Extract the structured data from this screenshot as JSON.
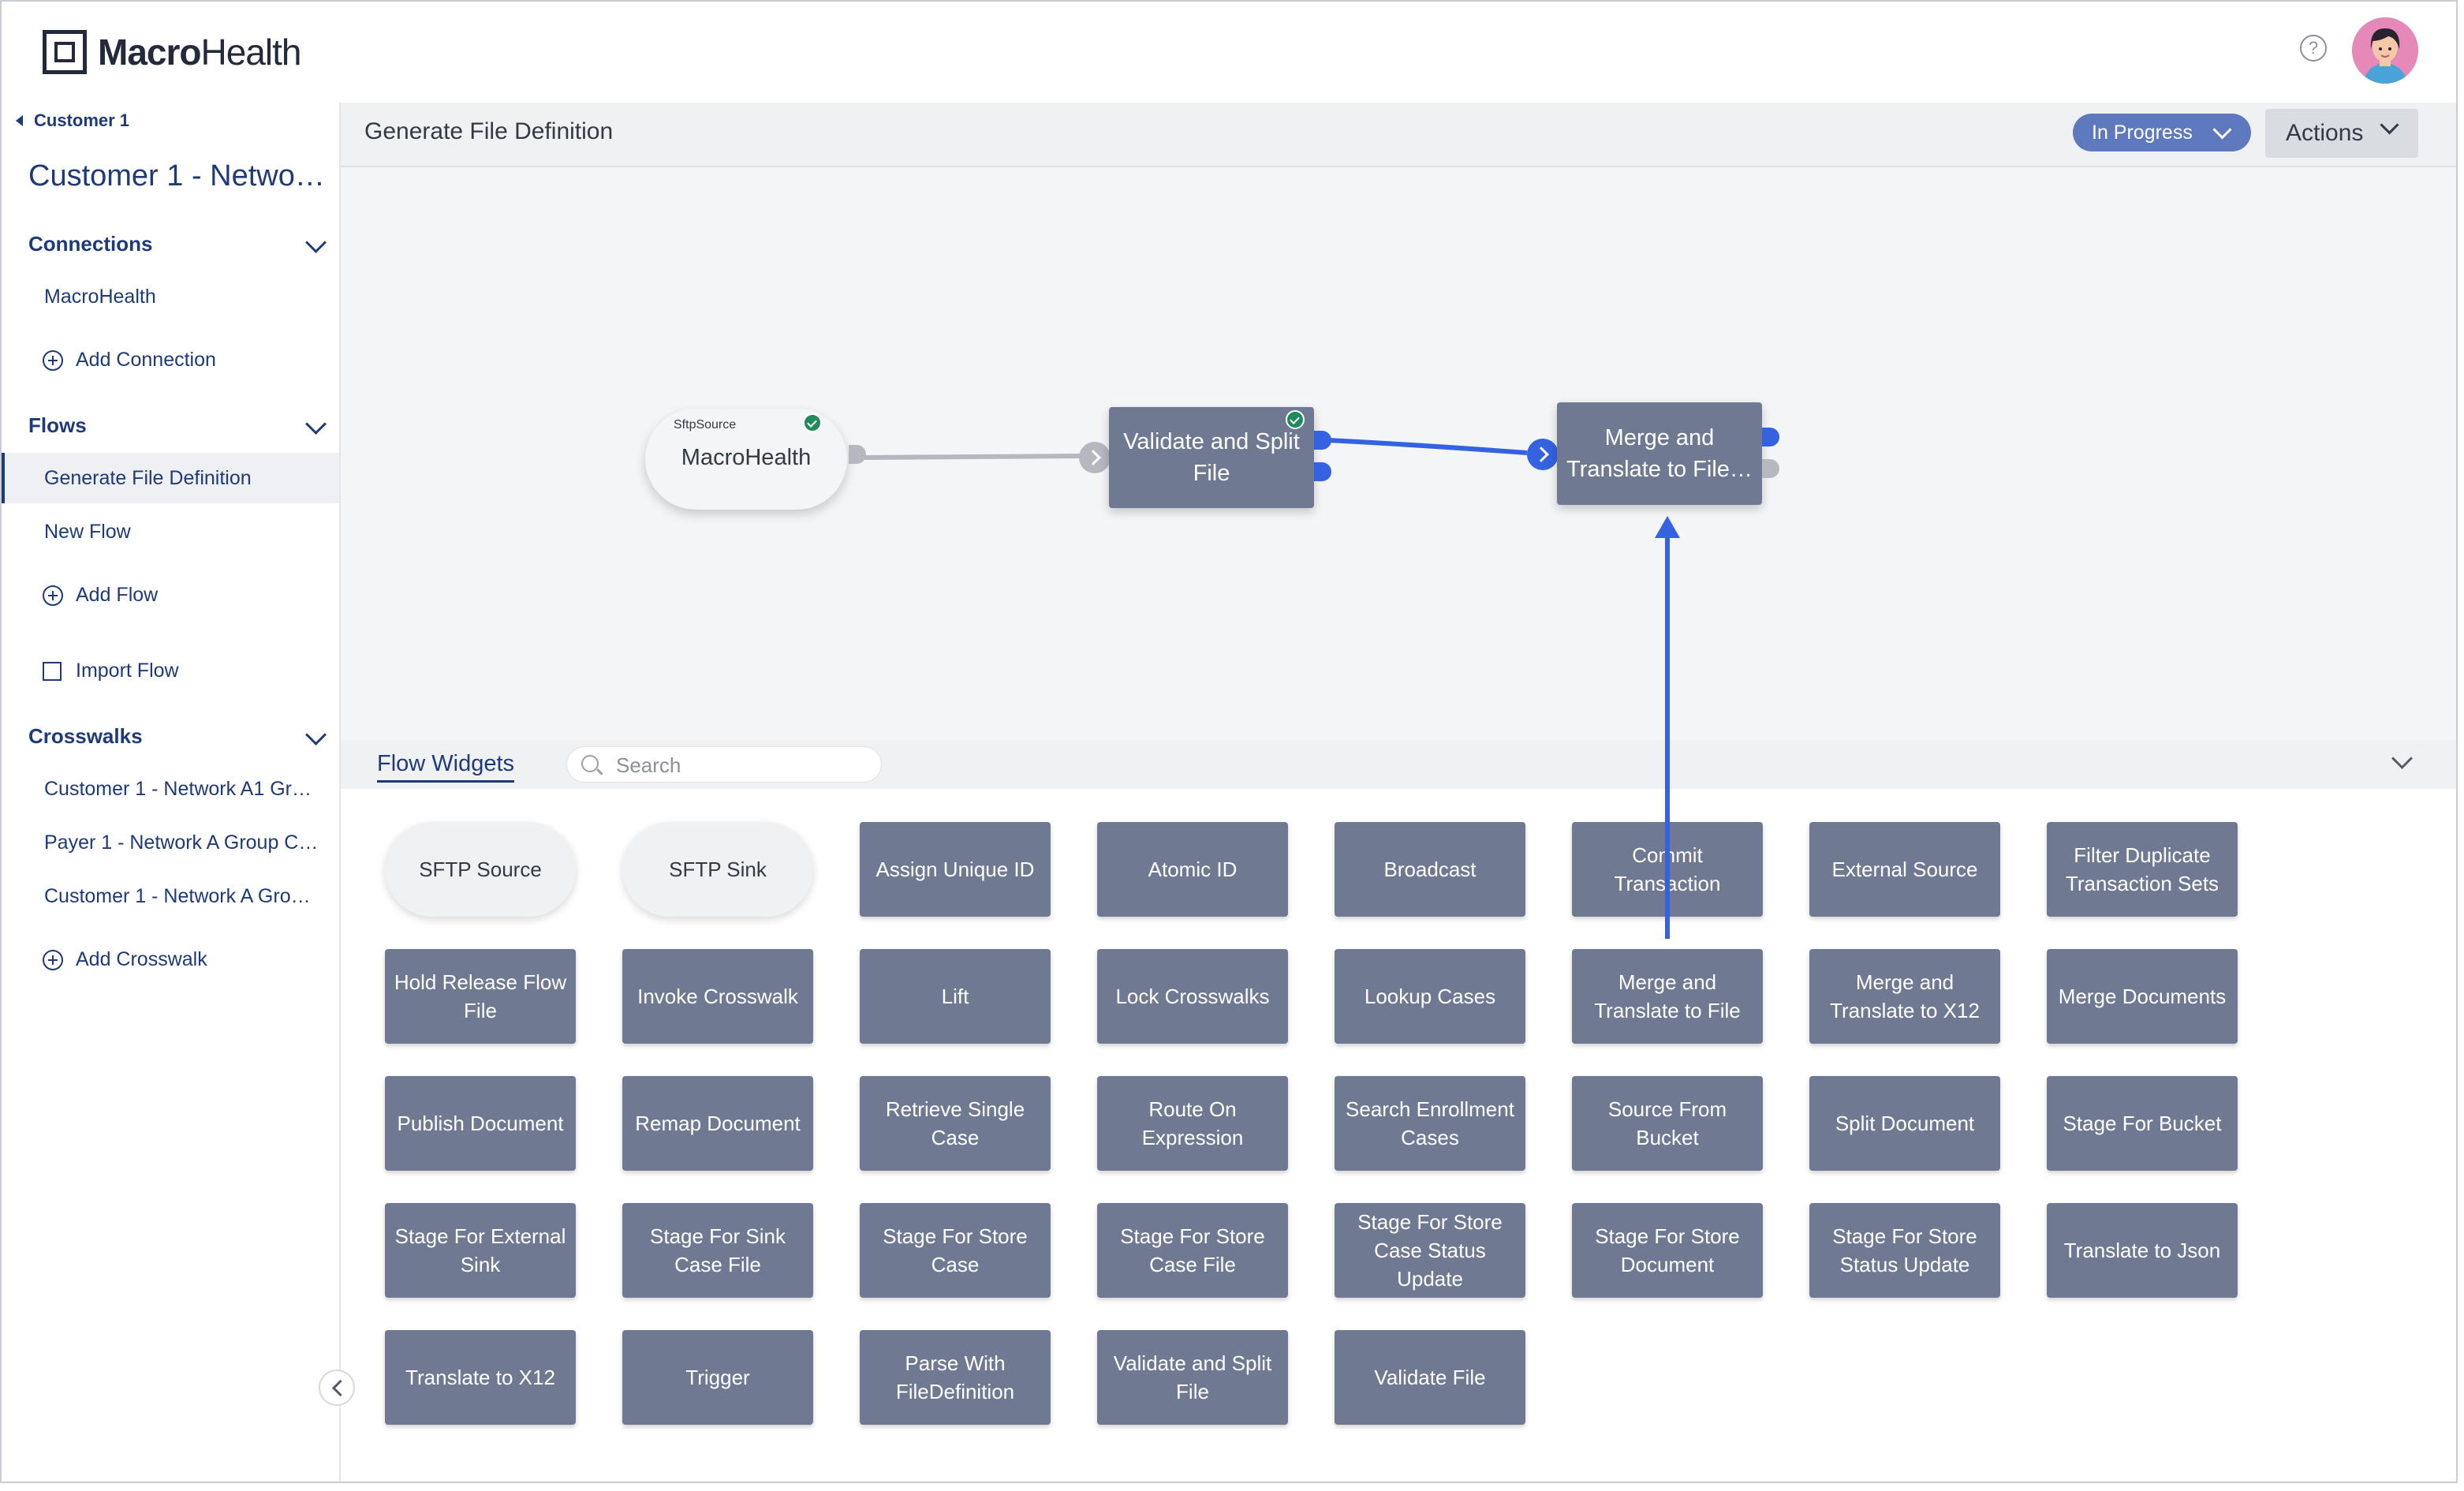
{
  "app": {
    "brand_bold": "Macro",
    "brand_regular": "Health",
    "help_glyph": "?"
  },
  "sidebar": {
    "back_label": "Customer 1",
    "title": "Customer 1 - Netwo…",
    "connections": {
      "label": "Connections",
      "items": [
        "MacroHealth"
      ],
      "add_label": "Add Connection"
    },
    "flows": {
      "label": "Flows",
      "items": [
        "Generate File Definition",
        "New Flow"
      ],
      "active": "Generate File Definition",
      "add_label": "Add Flow",
      "import_label": "Import Flow"
    },
    "crosswalks": {
      "label": "Crosswalks",
      "items": [
        "Customer 1 - Network A1 Gr…",
        "Payer 1 - Network A Group C…",
        "Customer 1 - Network A Gro…"
      ],
      "add_label": "Add Crosswalk"
    }
  },
  "header": {
    "title": "Generate File Definition",
    "status": "In Progress",
    "actions": "Actions"
  },
  "canvas": {
    "source_node": {
      "type_label": "SftpSource",
      "name": "MacroHealth"
    },
    "validate_node": {
      "line1": "Validate and Split",
      "line2": "File"
    },
    "merge_node": {
      "line1": "Merge and",
      "line2": "Translate to File…"
    }
  },
  "widgets": {
    "tab_label": "Flow Widgets",
    "search_placeholder": "Search",
    "items": [
      "SFTP Source",
      "SFTP Sink",
      "Assign Unique ID",
      "Atomic ID",
      "Broadcast",
      "Commit Transaction",
      "External Source",
      "Filter Duplicate Transaction Sets",
      "Hold Release Flow File",
      "Invoke Crosswalk",
      "Lift",
      "Lock Crosswalks",
      "Lookup Cases",
      "Merge and Translate to File",
      "Merge and Translate to X12",
      "Merge Documents",
      "Publish Document",
      "Remap Document",
      "Retrieve Single Case",
      "Route On Expression",
      "Search Enrollment Cases",
      "Source From Bucket",
      "Split Document",
      "Stage For Bucket",
      "Stage For External Sink",
      "Stage For Sink Case File",
      "Stage For Store Case",
      "Stage For Store Case File",
      "Stage For Store Case Status Update",
      "Stage For Store Document",
      "Stage For Store Status Update",
      "Translate to Json",
      "Translate to X12",
      "Trigger",
      "Parse With FileDefinition",
      "Validate and Split File",
      "Validate File"
    ]
  },
  "colors": {
    "brand_navy": "#1e3a78",
    "widget_bg": "#6f7a92",
    "status_blue": "#5f79bf",
    "connector_blue": "#3462e0",
    "check_green": "#1f8a5b"
  }
}
